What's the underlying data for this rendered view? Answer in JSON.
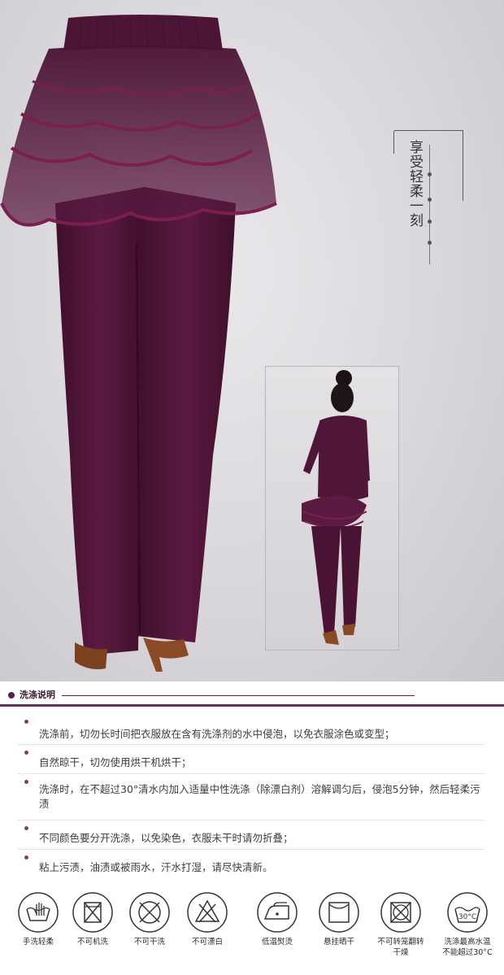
{
  "tagline": "享受轻柔一刻",
  "section": {
    "title": "洗涤说明"
  },
  "care_instructions": [
    "洗涤前，切勿长时间把衣服放在含有洗涤剂的水中侵泡，以免衣服涂色或变型；",
    "自然晾干，切勿使用烘干机烘干；",
    "洗涤时，在不超过30°清水内加入适量中性洗涤（除漂白剂）溶解调匀后，侵泡5分钟，然后轻柔污渍",
    "不同颜色要分开洗涤，以免染色，衣服未干时请勿折叠；",
    "粘上污渍，油渍或被雨水，汗水打湿，请尽快清新。"
  ],
  "care_icons": [
    {
      "icon": "hand-wash-icon",
      "label": "手洗轻柔"
    },
    {
      "icon": "no-machine-wash-icon",
      "label": "不可机洗"
    },
    {
      "icon": "no-dry-clean-icon",
      "label": "不可干洗"
    },
    {
      "icon": "no-bleach-icon",
      "label": "不可漂白"
    },
    {
      "icon": "low-iron-icon",
      "label": "低温熨烫"
    },
    {
      "icon": "hang-dry-icon",
      "label": "悬挂晒干"
    },
    {
      "icon": "no-tumble-dry-icon",
      "label": "不可转笼翻转干燥"
    },
    {
      "icon": "max-wash-temp-icon",
      "label": "洗涤最高水温不能超过30°C",
      "temp": "30°C"
    }
  ],
  "colors": {
    "garment": "#4f1638",
    "accent": "#6b2a63",
    "band": "#6b2a63"
  }
}
